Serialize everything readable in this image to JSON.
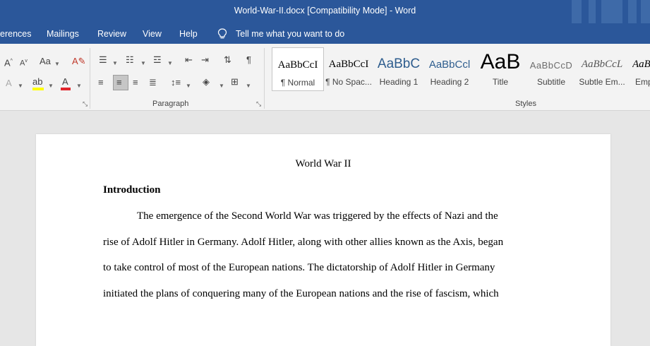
{
  "window": {
    "title": "World-War-II.docx  [Compatibility Mode]  -  Word",
    "title_bar_color": "#2b579a"
  },
  "tabs": [
    {
      "label": "erences"
    },
    {
      "label": "Mailings"
    },
    {
      "label": "Review"
    },
    {
      "label": "View"
    },
    {
      "label": "Help"
    }
  ],
  "tell_me": {
    "placeholder": "Tell me what you want to do",
    "icon": "lightbulb-icon"
  },
  "ribbon": {
    "paragraph_group_label": "Paragraph",
    "styles_group_label": "Styles",
    "styles": [
      {
        "sample": "AaBbCcI",
        "name": "¶ Normal",
        "selected": true
      },
      {
        "sample": "AaBbCcI",
        "name": "¶ No Spac...",
        "selected": false
      },
      {
        "sample": "AaBbC",
        "name": "Heading 1",
        "selected": false
      },
      {
        "sample": "AaBbCcl",
        "name": "Heading 2",
        "selected": false
      },
      {
        "sample": "AaB",
        "name": "Title",
        "selected": false
      },
      {
        "sample": "AaBbCcD",
        "name": "Subtitle",
        "selected": false
      },
      {
        "sample": "AaBbCcL",
        "name": "Subtle Em...",
        "selected": false
      },
      {
        "sample": "AaB",
        "name": "Emp",
        "selected": false
      }
    ]
  },
  "document": {
    "title": "World War II",
    "heading": "Introduction",
    "lines": [
      "The emergence of the Second World War was triggered by the effects of Nazi and the",
      "rise of Adolf Hitler in Germany. Adolf Hitler, along with other allies known as the Axis, began",
      "to take control of most of the European nations. The dictatorship of Adolf Hitler in Germany",
      "initiated the plans of conquering many of the European nations and the rise of fascism, which"
    ]
  }
}
